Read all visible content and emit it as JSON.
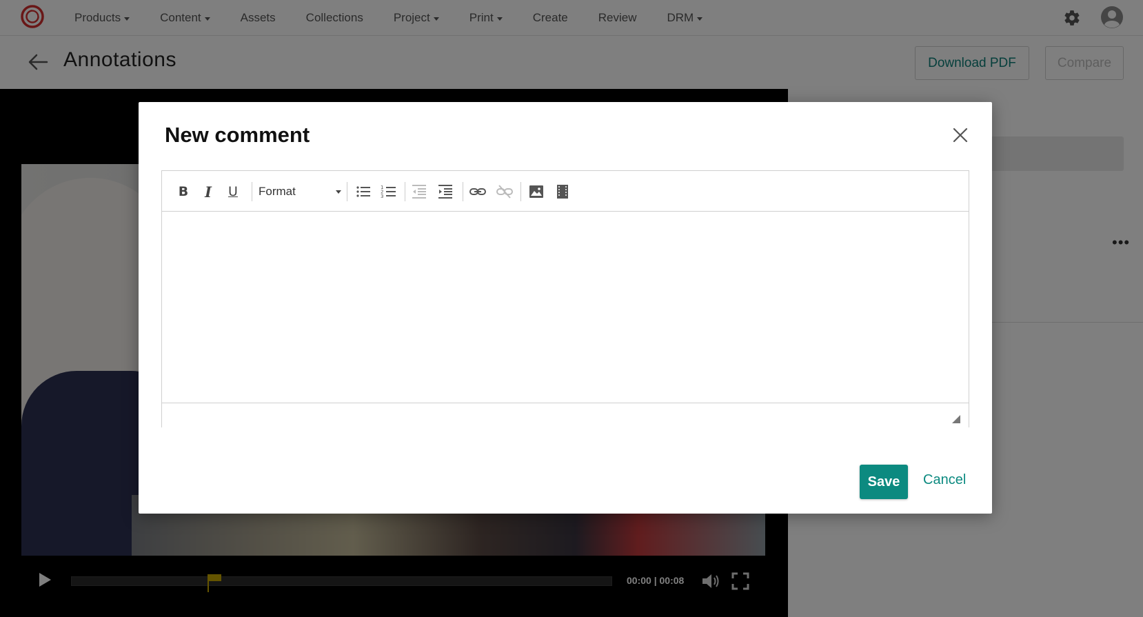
{
  "nav": {
    "items": [
      {
        "label": "Products",
        "dropdown": true
      },
      {
        "label": "Content",
        "dropdown": true
      },
      {
        "label": "Assets",
        "dropdown": false
      },
      {
        "label": "Collections",
        "dropdown": false
      },
      {
        "label": "Project",
        "dropdown": true
      },
      {
        "label": "Print",
        "dropdown": true
      },
      {
        "label": "Create",
        "dropdown": false
      },
      {
        "label": "Review",
        "dropdown": false
      },
      {
        "label": "DRM",
        "dropdown": true
      }
    ],
    "icons": {
      "logo": "brand-logo-icon",
      "settings": "gear-icon",
      "account": "user-avatar-icon"
    }
  },
  "header": {
    "title": "Annotations",
    "download_label": "Download PDF",
    "compare_label": "Compare"
  },
  "player": {
    "time_display": "00:00 | 00:08",
    "progress": 0.0,
    "marker_position": 0.16
  },
  "modal": {
    "title": "New comment",
    "toolbar": {
      "bold": "B",
      "italic": "I",
      "underline": "U",
      "format_label": "Format"
    },
    "content_value": "",
    "save_label": "Save",
    "cancel_label": "Cancel"
  },
  "colors": {
    "accent": "#0c8a80",
    "brand_red": "#d32f2f",
    "overlay": "rgba(0,0,0,0.5)",
    "marker": "#c9a900"
  }
}
